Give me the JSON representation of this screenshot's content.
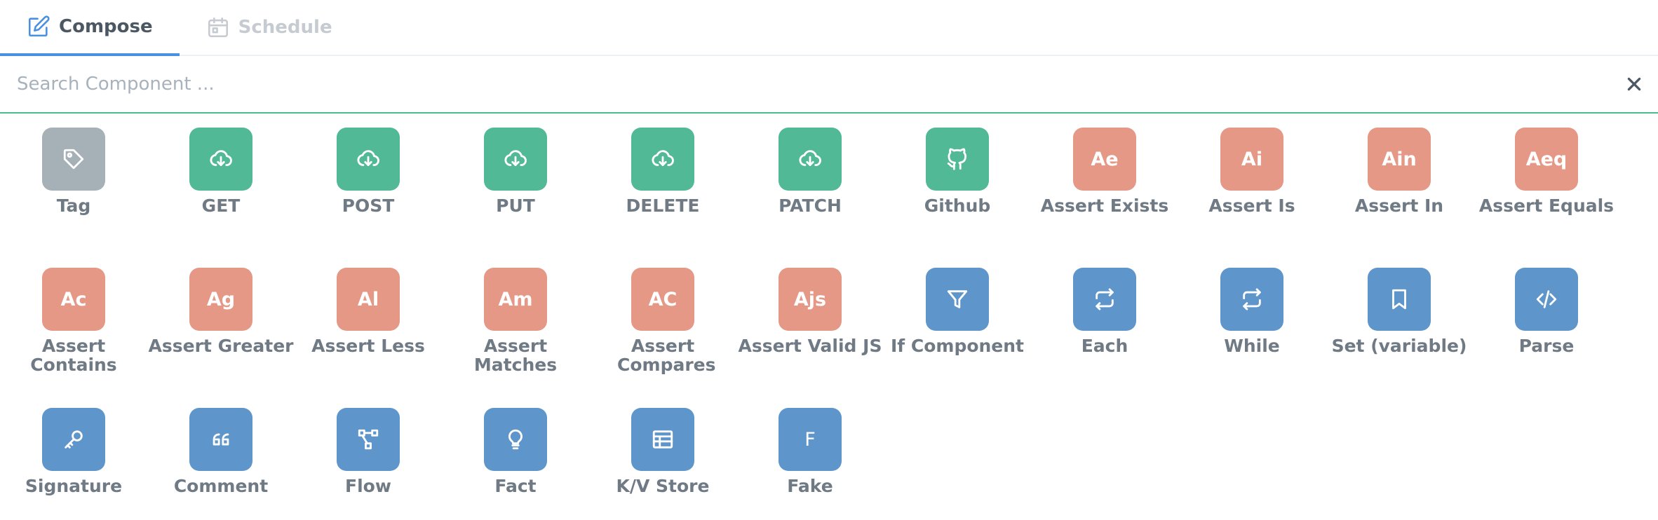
{
  "tabs": [
    {
      "label": "Compose",
      "active": true
    },
    {
      "label": "Schedule",
      "active": false
    }
  ],
  "search": {
    "placeholder": "Search Component ..."
  },
  "colors": {
    "gray": "#a6b0b7",
    "green": "#52b996",
    "salmon": "#e59885",
    "blue": "#5e95ca",
    "accent": "#4a90e2",
    "search_border": "#4cbb8f"
  },
  "components": [
    {
      "label": "Tag",
      "icon": "tag-icon",
      "color": "gray"
    },
    {
      "label": "GET",
      "icon": "cloud-download-icon",
      "color": "green"
    },
    {
      "label": "POST",
      "icon": "cloud-download-icon",
      "color": "green"
    },
    {
      "label": "PUT",
      "icon": "cloud-download-icon",
      "color": "green"
    },
    {
      "label": "DELETE",
      "icon": "cloud-download-icon",
      "color": "green"
    },
    {
      "label": "PATCH",
      "icon": "cloud-download-icon",
      "color": "green"
    },
    {
      "label": "Github",
      "icon": "github-icon",
      "color": "green"
    },
    {
      "label": "Assert Exists",
      "abbr": "Ae",
      "color": "salmon"
    },
    {
      "label": "Assert Is",
      "abbr": "Ai",
      "color": "salmon"
    },
    {
      "label": "Assert In",
      "abbr": "Ain",
      "color": "salmon"
    },
    {
      "label": "Assert Equals",
      "abbr": "Aeq",
      "color": "salmon"
    },
    {
      "label": "Assert Contains",
      "abbr": "Ac",
      "color": "salmon"
    },
    {
      "label": "Assert Greater",
      "abbr": "Ag",
      "color": "salmon"
    },
    {
      "label": "Assert Less",
      "abbr": "Al",
      "color": "salmon"
    },
    {
      "label": "Assert Matches",
      "abbr": "Am",
      "color": "salmon"
    },
    {
      "label": "Assert Compares",
      "abbr": "AC",
      "color": "salmon"
    },
    {
      "label": "Assert Valid JS",
      "abbr": "Ajs",
      "color": "salmon"
    },
    {
      "label": "If Component",
      "icon": "filter-icon",
      "color": "blue"
    },
    {
      "label": "Each",
      "icon": "repeat-icon",
      "color": "blue"
    },
    {
      "label": "While",
      "icon": "repeat-icon",
      "color": "blue"
    },
    {
      "label": "Set (variable)",
      "icon": "bookmark-icon",
      "color": "blue"
    },
    {
      "label": "Parse",
      "icon": "code-icon",
      "color": "blue"
    },
    {
      "label": "Signature",
      "icon": "key-icon",
      "color": "blue"
    },
    {
      "label": "Comment",
      "icon": "quote-icon",
      "color": "blue"
    },
    {
      "label": "Flow",
      "icon": "flow-icon",
      "color": "blue"
    },
    {
      "label": "Fact",
      "icon": "lightbulb-icon",
      "color": "blue"
    },
    {
      "label": "K/V Store",
      "icon": "table-icon",
      "color": "blue"
    },
    {
      "label": "Fake",
      "abbr": "F",
      "color": "blue"
    }
  ]
}
